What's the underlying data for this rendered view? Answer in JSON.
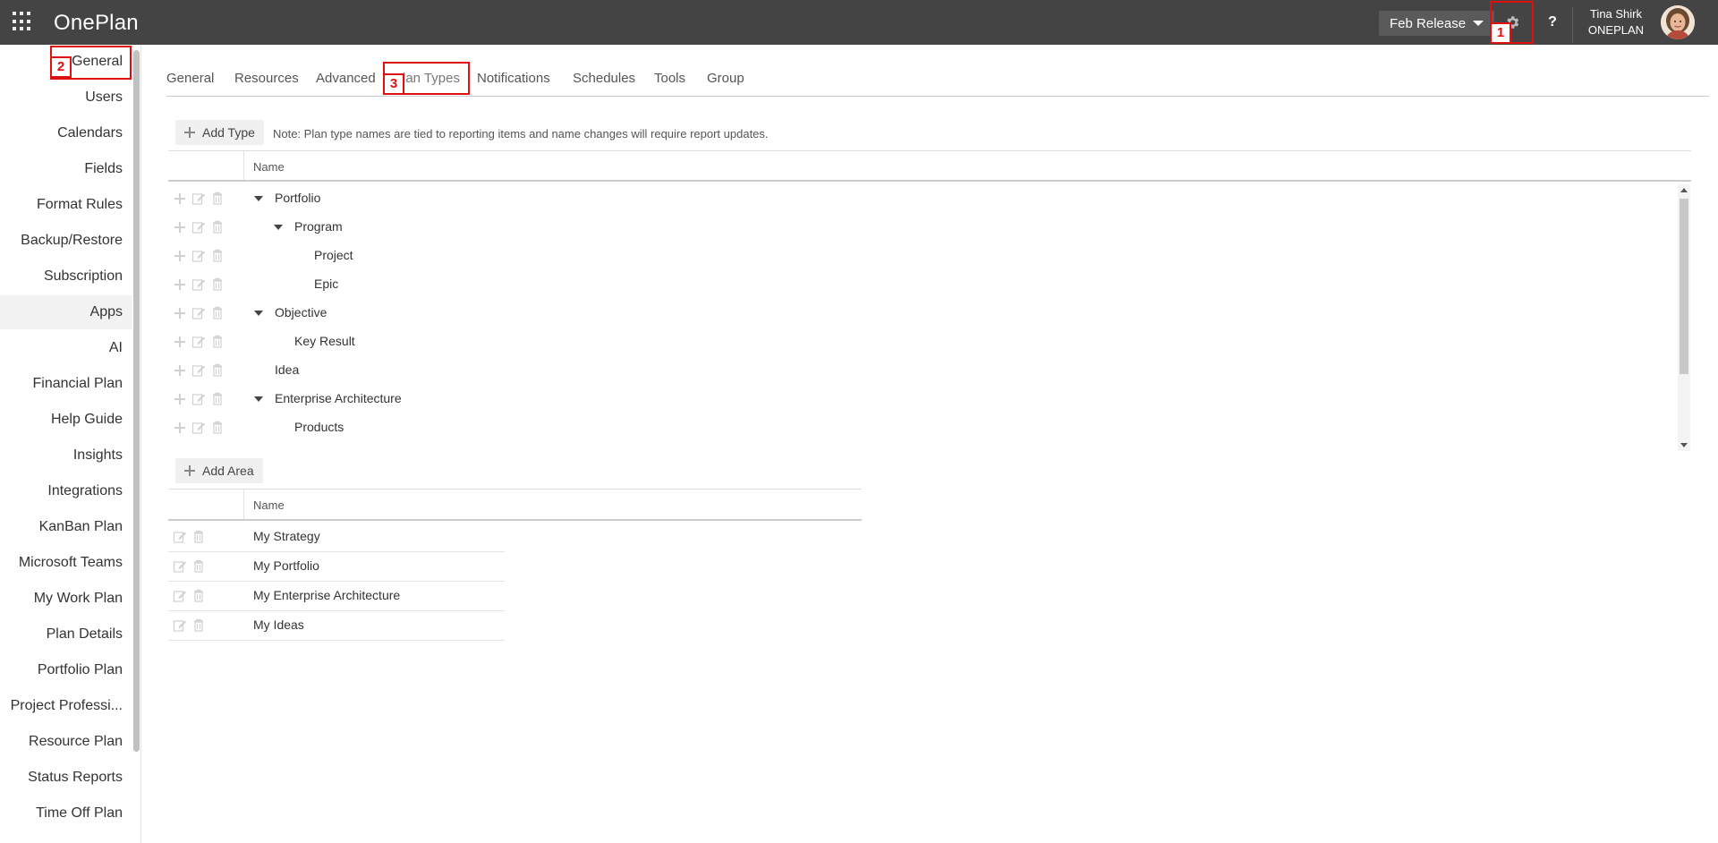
{
  "header": {
    "app_title": "OnePlan",
    "release_label": "Feb Release",
    "help_label": "?",
    "user_name": "Tina Shirk",
    "user_org": "ONEPLAN"
  },
  "annotations": [
    "1",
    "2",
    "3"
  ],
  "sidebar": {
    "items": [
      {
        "label": "General"
      },
      {
        "label": "Users"
      },
      {
        "label": "Calendars"
      },
      {
        "label": "Fields"
      },
      {
        "label": "Format Rules"
      },
      {
        "label": "Backup/Restore"
      },
      {
        "label": "Subscription"
      },
      {
        "label": "Apps"
      },
      {
        "label": "AI"
      },
      {
        "label": "Financial Plan"
      },
      {
        "label": "Help Guide"
      },
      {
        "label": "Insights"
      },
      {
        "label": "Integrations"
      },
      {
        "label": "KanBan Plan"
      },
      {
        "label": "Microsoft Teams"
      },
      {
        "label": "My Work Plan"
      },
      {
        "label": "Plan Details"
      },
      {
        "label": "Portfolio Plan"
      },
      {
        "label": "Project Professi..."
      },
      {
        "label": "Resource Plan"
      },
      {
        "label": "Status Reports"
      },
      {
        "label": "Time Off Plan"
      }
    ]
  },
  "tabs": [
    {
      "label": "General"
    },
    {
      "label": "Resources"
    },
    {
      "label": "Advanced"
    },
    {
      "label": "Plan Types"
    },
    {
      "label": "Notifications"
    },
    {
      "label": "Schedules"
    },
    {
      "label": "Tools"
    },
    {
      "label": "Group"
    }
  ],
  "plan_types": {
    "add_label": "Add Type",
    "note": "Note: Plan type names are tied to reporting items and name changes will require report updates.",
    "column_name": "Name",
    "rows": [
      {
        "label": "Portfolio"
      },
      {
        "label": "Program"
      },
      {
        "label": "Project"
      },
      {
        "label": "Epic"
      },
      {
        "label": "Objective"
      },
      {
        "label": "Key Result"
      },
      {
        "label": "Idea"
      },
      {
        "label": "Enterprise Architecture"
      },
      {
        "label": "Products"
      }
    ]
  },
  "areas": {
    "add_label": "Add Area",
    "column_name": "Name",
    "rows": [
      {
        "label": "My Strategy"
      },
      {
        "label": "My Portfolio"
      },
      {
        "label": "My Enterprise Architecture"
      },
      {
        "label": "My Ideas"
      }
    ]
  },
  "colors": {
    "topbar": "#444444",
    "annotation_red": "#e01010",
    "icon_gray": "#c8c8c8"
  }
}
